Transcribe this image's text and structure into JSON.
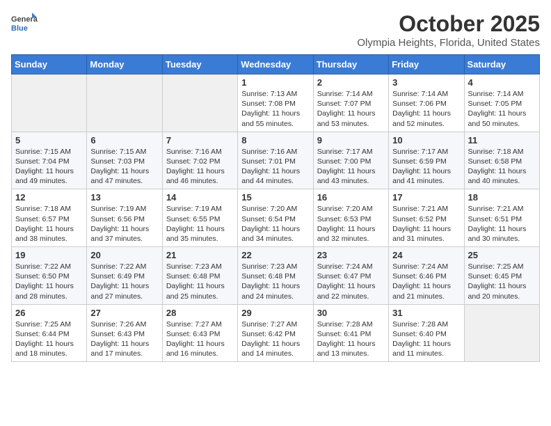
{
  "header": {
    "logo_general": "General",
    "logo_blue": "Blue",
    "month": "October 2025",
    "location": "Olympia Heights, Florida, United States"
  },
  "weekdays": [
    "Sunday",
    "Monday",
    "Tuesday",
    "Wednesday",
    "Thursday",
    "Friday",
    "Saturday"
  ],
  "weeks": [
    [
      {
        "day": "",
        "sunrise": "",
        "sunset": "",
        "daylight": ""
      },
      {
        "day": "",
        "sunrise": "",
        "sunset": "",
        "daylight": ""
      },
      {
        "day": "",
        "sunrise": "",
        "sunset": "",
        "daylight": ""
      },
      {
        "day": "1",
        "sunrise": "Sunrise: 7:13 AM",
        "sunset": "Sunset: 7:08 PM",
        "daylight": "Daylight: 11 hours and 55 minutes."
      },
      {
        "day": "2",
        "sunrise": "Sunrise: 7:14 AM",
        "sunset": "Sunset: 7:07 PM",
        "daylight": "Daylight: 11 hours and 53 minutes."
      },
      {
        "day": "3",
        "sunrise": "Sunrise: 7:14 AM",
        "sunset": "Sunset: 7:06 PM",
        "daylight": "Daylight: 11 hours and 52 minutes."
      },
      {
        "day": "4",
        "sunrise": "Sunrise: 7:14 AM",
        "sunset": "Sunset: 7:05 PM",
        "daylight": "Daylight: 11 hours and 50 minutes."
      }
    ],
    [
      {
        "day": "5",
        "sunrise": "Sunrise: 7:15 AM",
        "sunset": "Sunset: 7:04 PM",
        "daylight": "Daylight: 11 hours and 49 minutes."
      },
      {
        "day": "6",
        "sunrise": "Sunrise: 7:15 AM",
        "sunset": "Sunset: 7:03 PM",
        "daylight": "Daylight: 11 hours and 47 minutes."
      },
      {
        "day": "7",
        "sunrise": "Sunrise: 7:16 AM",
        "sunset": "Sunset: 7:02 PM",
        "daylight": "Daylight: 11 hours and 46 minutes."
      },
      {
        "day": "8",
        "sunrise": "Sunrise: 7:16 AM",
        "sunset": "Sunset: 7:01 PM",
        "daylight": "Daylight: 11 hours and 44 minutes."
      },
      {
        "day": "9",
        "sunrise": "Sunrise: 7:17 AM",
        "sunset": "Sunset: 7:00 PM",
        "daylight": "Daylight: 11 hours and 43 minutes."
      },
      {
        "day": "10",
        "sunrise": "Sunrise: 7:17 AM",
        "sunset": "Sunset: 6:59 PM",
        "daylight": "Daylight: 11 hours and 41 minutes."
      },
      {
        "day": "11",
        "sunrise": "Sunrise: 7:18 AM",
        "sunset": "Sunset: 6:58 PM",
        "daylight": "Daylight: 11 hours and 40 minutes."
      }
    ],
    [
      {
        "day": "12",
        "sunrise": "Sunrise: 7:18 AM",
        "sunset": "Sunset: 6:57 PM",
        "daylight": "Daylight: 11 hours and 38 minutes."
      },
      {
        "day": "13",
        "sunrise": "Sunrise: 7:19 AM",
        "sunset": "Sunset: 6:56 PM",
        "daylight": "Daylight: 11 hours and 37 minutes."
      },
      {
        "day": "14",
        "sunrise": "Sunrise: 7:19 AM",
        "sunset": "Sunset: 6:55 PM",
        "daylight": "Daylight: 11 hours and 35 minutes."
      },
      {
        "day": "15",
        "sunrise": "Sunrise: 7:20 AM",
        "sunset": "Sunset: 6:54 PM",
        "daylight": "Daylight: 11 hours and 34 minutes."
      },
      {
        "day": "16",
        "sunrise": "Sunrise: 7:20 AM",
        "sunset": "Sunset: 6:53 PM",
        "daylight": "Daylight: 11 hours and 32 minutes."
      },
      {
        "day": "17",
        "sunrise": "Sunrise: 7:21 AM",
        "sunset": "Sunset: 6:52 PM",
        "daylight": "Daylight: 11 hours and 31 minutes."
      },
      {
        "day": "18",
        "sunrise": "Sunrise: 7:21 AM",
        "sunset": "Sunset: 6:51 PM",
        "daylight": "Daylight: 11 hours and 30 minutes."
      }
    ],
    [
      {
        "day": "19",
        "sunrise": "Sunrise: 7:22 AM",
        "sunset": "Sunset: 6:50 PM",
        "daylight": "Daylight: 11 hours and 28 minutes."
      },
      {
        "day": "20",
        "sunrise": "Sunrise: 7:22 AM",
        "sunset": "Sunset: 6:49 PM",
        "daylight": "Daylight: 11 hours and 27 minutes."
      },
      {
        "day": "21",
        "sunrise": "Sunrise: 7:23 AM",
        "sunset": "Sunset: 6:48 PM",
        "daylight": "Daylight: 11 hours and 25 minutes."
      },
      {
        "day": "22",
        "sunrise": "Sunrise: 7:23 AM",
        "sunset": "Sunset: 6:48 PM",
        "daylight": "Daylight: 11 hours and 24 minutes."
      },
      {
        "day": "23",
        "sunrise": "Sunrise: 7:24 AM",
        "sunset": "Sunset: 6:47 PM",
        "daylight": "Daylight: 11 hours and 22 minutes."
      },
      {
        "day": "24",
        "sunrise": "Sunrise: 7:24 AM",
        "sunset": "Sunset: 6:46 PM",
        "daylight": "Daylight: 11 hours and 21 minutes."
      },
      {
        "day": "25",
        "sunrise": "Sunrise: 7:25 AM",
        "sunset": "Sunset: 6:45 PM",
        "daylight": "Daylight: 11 hours and 20 minutes."
      }
    ],
    [
      {
        "day": "26",
        "sunrise": "Sunrise: 7:25 AM",
        "sunset": "Sunset: 6:44 PM",
        "daylight": "Daylight: 11 hours and 18 minutes."
      },
      {
        "day": "27",
        "sunrise": "Sunrise: 7:26 AM",
        "sunset": "Sunset: 6:43 PM",
        "daylight": "Daylight: 11 hours and 17 minutes."
      },
      {
        "day": "28",
        "sunrise": "Sunrise: 7:27 AM",
        "sunset": "Sunset: 6:43 PM",
        "daylight": "Daylight: 11 hours and 16 minutes."
      },
      {
        "day": "29",
        "sunrise": "Sunrise: 7:27 AM",
        "sunset": "Sunset: 6:42 PM",
        "daylight": "Daylight: 11 hours and 14 minutes."
      },
      {
        "day": "30",
        "sunrise": "Sunrise: 7:28 AM",
        "sunset": "Sunset: 6:41 PM",
        "daylight": "Daylight: 11 hours and 13 minutes."
      },
      {
        "day": "31",
        "sunrise": "Sunrise: 7:28 AM",
        "sunset": "Sunset: 6:40 PM",
        "daylight": "Daylight: 11 hours and 11 minutes."
      },
      {
        "day": "",
        "sunrise": "",
        "sunset": "",
        "daylight": ""
      }
    ]
  ]
}
